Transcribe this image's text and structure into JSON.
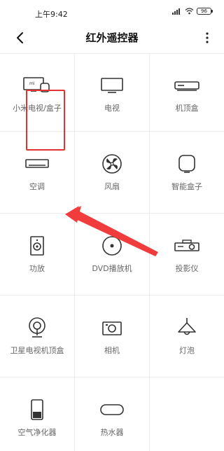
{
  "status_bar": {
    "time": "上午9:42",
    "battery": "96"
  },
  "header": {
    "title": "红外遥控器"
  },
  "devices": [
    {
      "label": "小米电视/盒子",
      "icon": "tv-box-icon"
    },
    {
      "label": "电视",
      "icon": "tv-icon"
    },
    {
      "label": "机顶盒",
      "icon": "settop-box-icon"
    },
    {
      "label": "空调",
      "icon": "air-conditioner-icon"
    },
    {
      "label": "风扇",
      "icon": "fan-icon"
    },
    {
      "label": "智能盒子",
      "icon": "smart-box-icon"
    },
    {
      "label": "功放",
      "icon": "amplifier-icon"
    },
    {
      "label": "DVD播放机",
      "icon": "dvd-player-icon"
    },
    {
      "label": "投影仪",
      "icon": "projector-icon"
    },
    {
      "label": "卫星电视机顶盒",
      "icon": "satellite-box-icon"
    },
    {
      "label": "相机",
      "icon": "camera-icon"
    },
    {
      "label": "灯泡",
      "icon": "light-bulb-icon"
    },
    {
      "label": "空气净化器",
      "icon": "air-purifier-icon"
    },
    {
      "label": "热水器",
      "icon": "water-heater-icon"
    }
  ],
  "annotation": {
    "highlight_color": "#e33232"
  }
}
